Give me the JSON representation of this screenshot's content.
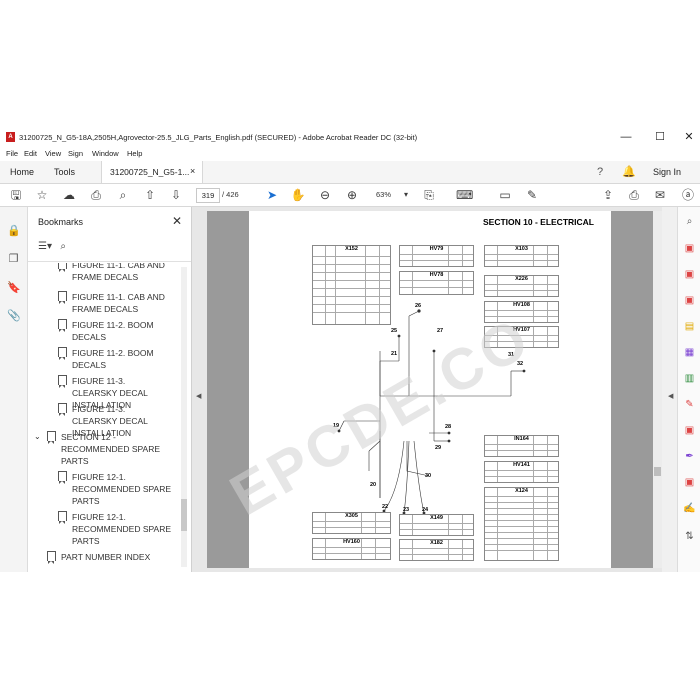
{
  "window": {
    "title": "31200725_N_G5-18A,2505H,Agrovector-25.5_JLG_Parts_English.pdf (SECURED) - Adobe Acrobat Reader DC (32-bit)",
    "app_icon": "acrobat-icon",
    "controls": {
      "minimize": "—",
      "maximize": "☐",
      "close": "✕"
    }
  },
  "menu": [
    "File",
    "Edit",
    "View",
    "Sign",
    "Window",
    "Help"
  ],
  "tabs": {
    "home": "Home",
    "tools": "Tools",
    "document": "31200725_N_G5-1...",
    "doc_close": "×",
    "sign_in": "Sign In"
  },
  "toolbar": {
    "current_page": "319",
    "total_pages": "/ 426",
    "zoom": "63%"
  },
  "bookmarks": {
    "title": "Bookmarks",
    "close": "✕",
    "items": [
      {
        "label": "FIGURE 11-1. CAB AND FRAME DECALS",
        "level": 2
      },
      {
        "label": "FIGURE 11-1. CAB AND FRAME DECALS",
        "level": 2
      },
      {
        "label": "FIGURE 11-2. BOOM DECALS",
        "level": 2
      },
      {
        "label": "FIGURE 11-2. BOOM DECALS",
        "level": 2
      },
      {
        "label": "FIGURE 11-3. CLEARSKY DECAL INSTALLATION",
        "level": 2
      },
      {
        "label": "FIGURE 11-3. CLEARSKY DECAL INSTALLATION",
        "level": 2
      },
      {
        "label": "SECTION 12 - RECOMMENDED SPARE PARTS",
        "level": 1
      },
      {
        "label": "FIGURE 12-1. RECOMMENDED SPARE PARTS",
        "level": 2
      },
      {
        "label": "FIGURE 12-1. RECOMMENDED SPARE PARTS",
        "level": 2
      },
      {
        "label": "PART NUMBER INDEX",
        "level": 1
      }
    ]
  },
  "document": {
    "section_title": "SECTION 10 - ELECTRICAL",
    "tables": [
      "X152",
      "HV79",
      "X103",
      "HV78",
      "X226",
      "HV108",
      "HV107",
      "X305",
      "X149",
      "HV160",
      "X182",
      "IN164",
      "HV141",
      "X124"
    ],
    "callouts": [
      "26",
      "25",
      "27",
      "21",
      "31",
      "32",
      "19",
      "28",
      "29",
      "30",
      "20",
      "22",
      "23",
      "24"
    ],
    "watermark": "EPCDE.CO"
  },
  "colors": {
    "acrobat_red": "#c81e1e",
    "doc_background": "#e7e7e7",
    "page_shadow": "#9a9a9a"
  }
}
